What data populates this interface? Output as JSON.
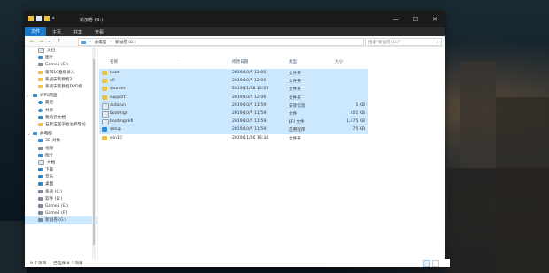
{
  "window": {
    "title": "新加卷 (G:)",
    "controls": [
      "—",
      "☐",
      "✕"
    ]
  },
  "ribbon": {
    "tabs": [
      "文件",
      "主页",
      "共享",
      "查看"
    ]
  },
  "address": {
    "back": "←",
    "forward": "→",
    "up": "↑",
    "path": [
      "此电脑",
      "新加卷 (G:)"
    ],
    "search_placeholder": "搜索\"新加卷 (G:)\""
  },
  "sidebar": {
    "items": [
      {
        "label": "文档",
        "icon": "document-icon",
        "pinned": true
      },
      {
        "label": "图片",
        "icon": "picture-icon",
        "pinned": true
      },
      {
        "label": "Game1 (E:)",
        "icon": "drive-icon",
        "pinned": true
      },
      {
        "label": "第四10直播录入",
        "icon": "folder-icon",
        "pinned": false
      },
      {
        "label": "系统安装教程2",
        "icon": "folder-icon",
        "pinned": false
      },
      {
        "label": "系统安装教程DVD版",
        "icon": "folder-icon",
        "pinned": false
      },
      {
        "label": "WPS网盘",
        "icon": "cloud-icon",
        "group": true
      },
      {
        "label": "最近",
        "icon": "recent-icon"
      },
      {
        "label": "共享",
        "icon": "share-icon"
      },
      {
        "label": "我的云文档",
        "icon": "cloud-doc-icon"
      },
      {
        "label": "石家庄医学会治病理论",
        "icon": "folder-icon"
      },
      {
        "label": "此电脑",
        "icon": "computer-icon",
        "group": true
      },
      {
        "label": "3D 对象",
        "icon": "cube-icon"
      },
      {
        "label": "视频",
        "icon": "video-icon"
      },
      {
        "label": "图片",
        "icon": "picture-icon"
      },
      {
        "label": "文档",
        "icon": "document-icon"
      },
      {
        "label": "下载",
        "icon": "download-icon"
      },
      {
        "label": "音乐",
        "icon": "music-icon"
      },
      {
        "label": "桌面",
        "icon": "desktop-icon"
      },
      {
        "label": "系统 (C:)",
        "icon": "drive-icon"
      },
      {
        "label": "软件 (D:)",
        "icon": "drive-icon"
      },
      {
        "label": "Game1 (E:)",
        "icon": "drive-icon"
      },
      {
        "label": "Game2 (F:)",
        "icon": "drive-icon"
      },
      {
        "label": "新加卷 (G:)",
        "icon": "drive-icon",
        "selected": true
      }
    ]
  },
  "columns": {
    "name": "名称",
    "modified": "修改日期",
    "type": "类型",
    "size": "大小"
  },
  "files": [
    {
      "name": "boot",
      "modified": "2019/10/7 12:06",
      "type": "文件夹",
      "size": "",
      "icon": "folder-icon",
      "selected": true
    },
    {
      "name": "efi",
      "modified": "2019/10/7 12:06",
      "type": "文件夹",
      "size": "",
      "icon": "folder-icon",
      "selected": true
    },
    {
      "name": "sources",
      "modified": "2019/11/28 15:23",
      "type": "文件夹",
      "size": "",
      "icon": "folder-icon",
      "selected": true
    },
    {
      "name": "support",
      "modified": "2019/10/7 12:06",
      "type": "文件夹",
      "size": "",
      "icon": "folder-icon",
      "selected": true
    },
    {
      "name": "autorun",
      "modified": "2019/10/7 11:59",
      "type": "安装信息",
      "size": "1 KB",
      "icon": "settings-file-icon",
      "selected": true
    },
    {
      "name": "bootmgr",
      "modified": "2019/10/7 11:59",
      "type": "文件",
      "size": "401 KB",
      "icon": "file-icon",
      "selected": true
    },
    {
      "name": "bootmgr.efi",
      "modified": "2019/10/7 11:59",
      "type": "EFI 文件",
      "size": "1,475 KB",
      "icon": "file-icon",
      "selected": true
    },
    {
      "name": "setup",
      "modified": "2019/10/7 11:59",
      "type": "应用程序",
      "size": "75 KB",
      "icon": "setup-icon",
      "selected": true
    },
    {
      "name": "win10",
      "modified": "2019/11/26 16:34",
      "type": "文件夹",
      "size": "",
      "icon": "folder-icon",
      "selected": false
    }
  ],
  "status": {
    "count": "9 个项目",
    "selected": "已选择 8 个项目"
  },
  "colors": {
    "selection": "#cce8ff",
    "ribbon_file": "#1979ca",
    "titlebar": "#1b1b1b"
  }
}
